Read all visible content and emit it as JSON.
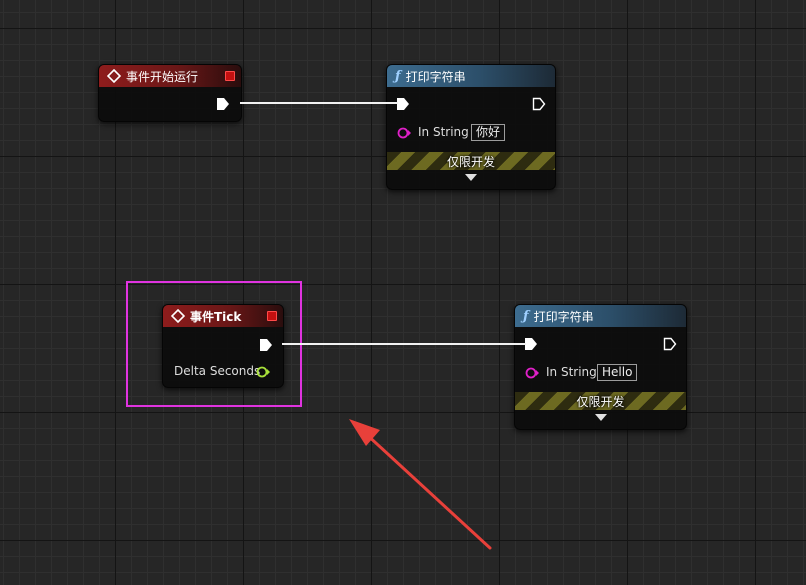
{
  "nodes": {
    "begin_play": {
      "title": "事件开始运行"
    },
    "print_string_1": {
      "title": "打印字符串",
      "in_string_label": "In String",
      "in_string_value": "你好",
      "dev_label": "仅限开发"
    },
    "event_tick": {
      "title": "事件Tick",
      "delta_label": "Delta Seconds"
    },
    "print_string_2": {
      "title": "打印字符串",
      "in_string_label": "In String",
      "in_string_value": "Hello",
      "dev_label": "仅限开发"
    }
  },
  "colors": {
    "highlight": "#e033e0",
    "annotation_arrow": "#e8403a",
    "event_header": "#8e1c1c",
    "function_header": "#3d6c8f",
    "string_pin": "#e020c8",
    "float_pin": "#a8e03a"
  },
  "icons": {
    "event": "event-diamond-icon",
    "function": "function-f-icon",
    "exec": "exec-pin-icon",
    "stop": "stop-square-icon"
  }
}
